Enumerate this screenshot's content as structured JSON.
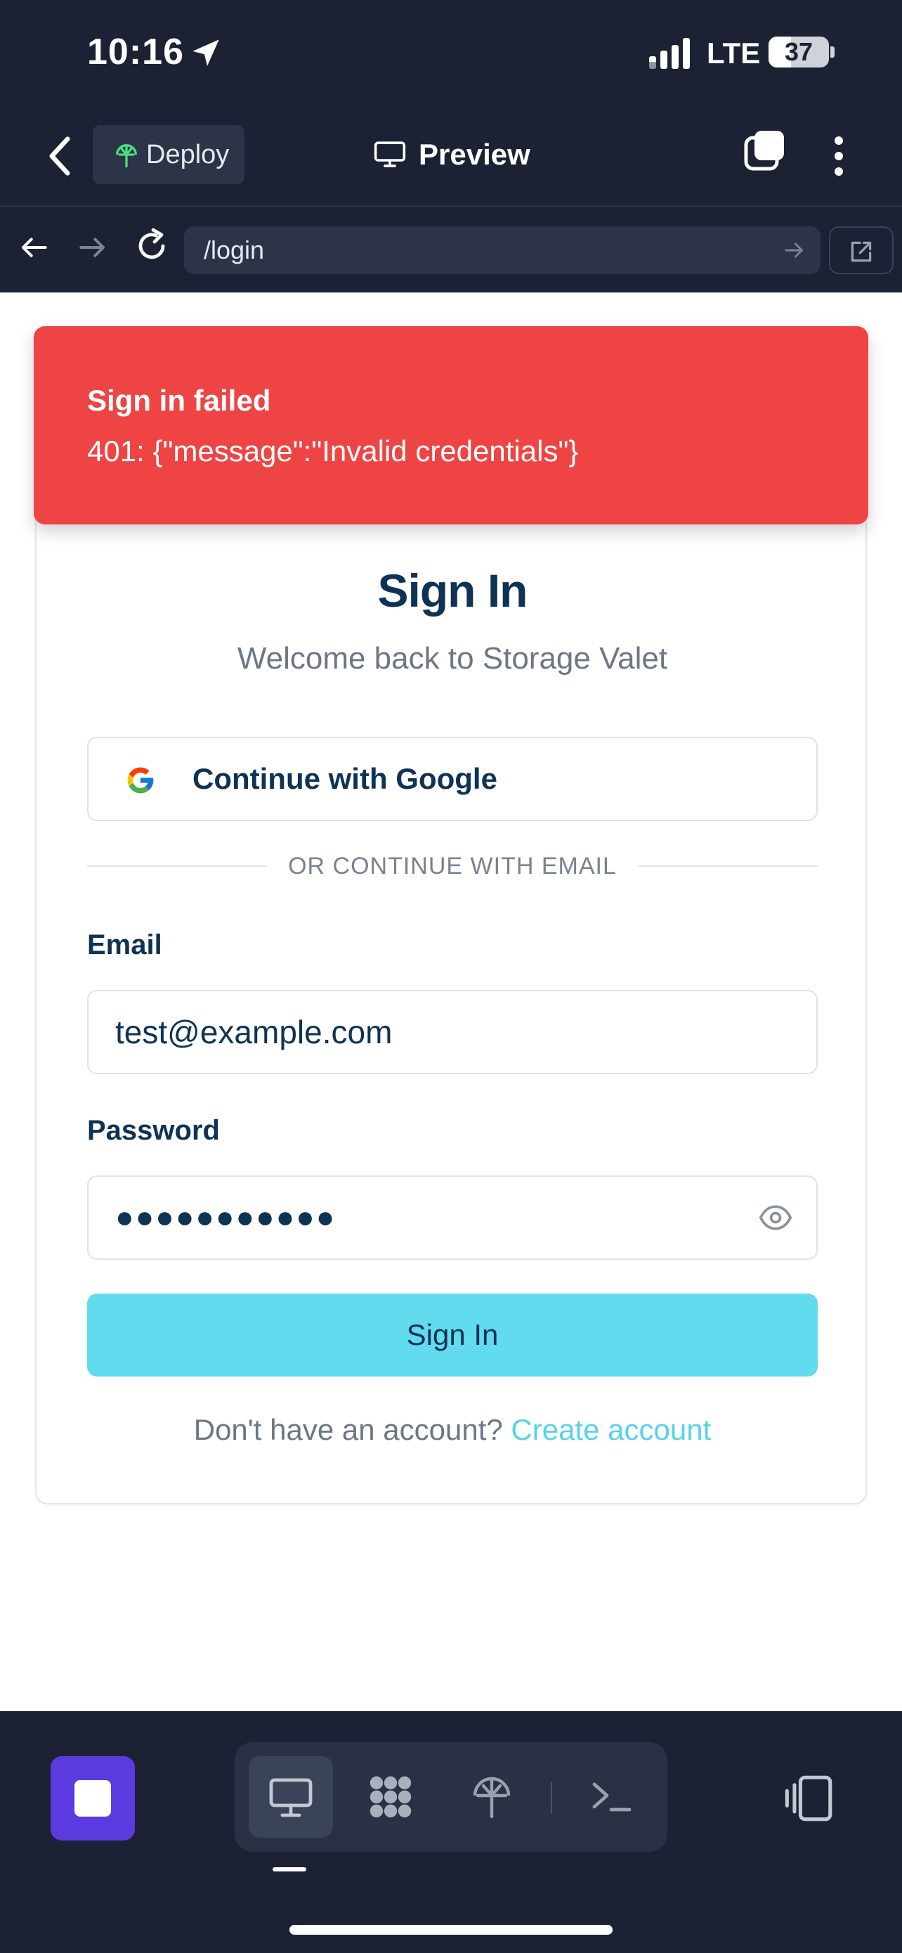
{
  "status_bar": {
    "time": "10:16",
    "network": "LTE",
    "battery": "37"
  },
  "nav": {
    "deploy_label": "Deploy",
    "preview_label": "Preview"
  },
  "browser": {
    "url": "/login"
  },
  "toast": {
    "title": "Sign in failed",
    "message": "401: {\"message\":\"Invalid credentials\"}"
  },
  "login": {
    "title": "Sign In",
    "subtitle": "Welcome back to Storage Valet",
    "google_label": "Continue with Google",
    "divider": "OR CONTINUE WITH EMAIL",
    "email_label": "Email",
    "email_value": "test@example.com",
    "password_label": "Password",
    "password_value": "●●●●●●●●●●●",
    "submit_label": "Sign In",
    "footer_prompt": "Don't have an account?",
    "footer_link": "Create account"
  },
  "bottom_tools": [
    "desktop-preview-icon",
    "apps-grid-icon",
    "deploy-icon",
    "terminal-icon"
  ],
  "colors": {
    "toast": "#ef4444",
    "primary": "#63dbee",
    "dark": "#1c2233",
    "stop": "#5b3be0"
  }
}
